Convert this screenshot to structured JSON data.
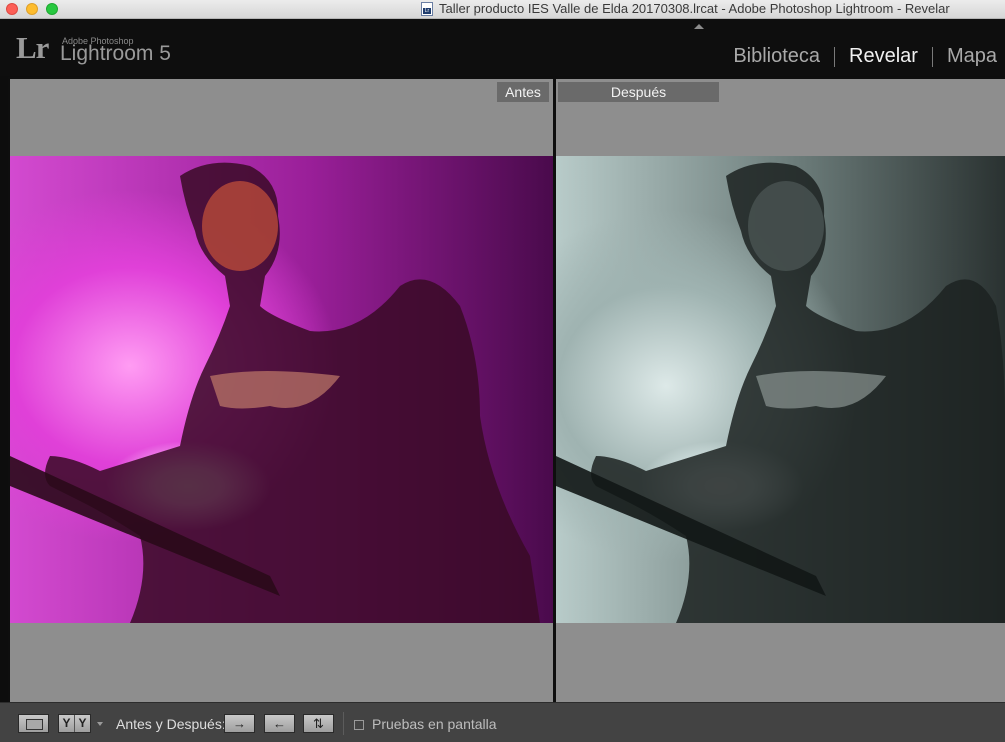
{
  "window": {
    "title": "Taller producto IES Valle de Elda 20170308.lrcat - Adobe Photoshop Lightroom - Revelar",
    "doc_icon_label": "Lr"
  },
  "app": {
    "logo": "Lr",
    "vendor": "Adobe Photoshop",
    "name": "Lightroom 5"
  },
  "modules": [
    {
      "label": "Biblioteca",
      "active": false
    },
    {
      "label": "Revelar",
      "active": true
    },
    {
      "label": "Mapa",
      "active": false
    }
  ],
  "compare": {
    "before_label": "Antes",
    "after_label": "Después"
  },
  "toolbar": {
    "view_mode_icon": "loupe-view-icon",
    "yy_left": "Y",
    "yy_right": "Y",
    "before_after_label": "Antes y Después:",
    "copy_before_to_after": "→",
    "copy_after_to_before": "←",
    "swap": "⇅",
    "soft_proofing_label": "Pruebas en pantalla",
    "soft_proofing_checked": false
  },
  "colors": {
    "accent_before": "#d34ad0",
    "accent_after": "#9fb3b1",
    "panel_bg": "#8e8e8e"
  }
}
